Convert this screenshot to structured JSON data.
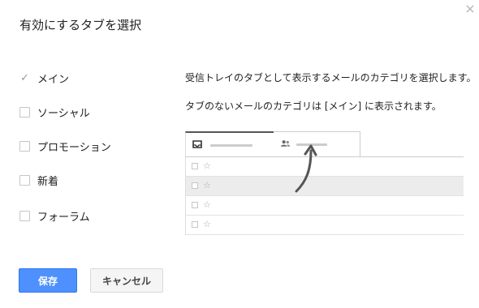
{
  "dialog": {
    "title": "有効にするタブを選択",
    "close_glyph": "×"
  },
  "options": [
    {
      "label": "メイン",
      "checked": true
    },
    {
      "label": "ソーシャル",
      "checked": false
    },
    {
      "label": "プロモーション",
      "checked": false
    },
    {
      "label": "新着",
      "checked": false
    },
    {
      "label": "フォーラム",
      "checked": false
    }
  ],
  "description": {
    "line1": "受信トレイのタブとして表示するメールのカテゴリを選択します。",
    "line2": "タブのないメールのカテゴリは [メイン] に表示されます。"
  },
  "preview": {
    "tabs": [
      {
        "icon": "inbox-icon"
      },
      {
        "icon": "people-icon"
      }
    ],
    "row_glyph_star": "☆",
    "row_count": 4
  },
  "buttons": {
    "save": "保存",
    "cancel": "キャンセル"
  },
  "colors": {
    "primary": "#4d90fe",
    "primary_border": "#3079ed"
  }
}
